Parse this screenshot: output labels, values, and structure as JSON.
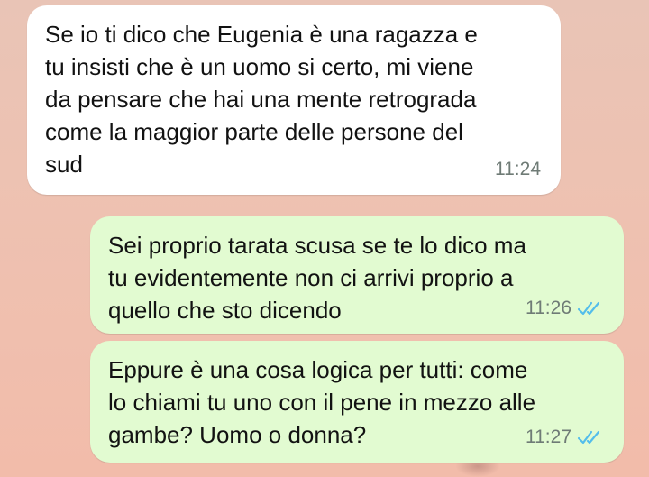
{
  "messages": [
    {
      "direction": "incoming",
      "text": "Se io ti dico che Eugenia è una ragazza e\ntu insisti che è un uomo si certo, mi viene\nda pensare che hai una mente retrograda\ncome la maggior parte delle persone del\nsud",
      "time": "11:24"
    },
    {
      "direction": "outgoing",
      "text": "Sei proprio tarata scusa se te lo dico ma\ntu evidentemente non ci arrivi proprio a\nquello che sto dicendo",
      "time": "11:26",
      "status_icon": "double-check-read-icon"
    },
    {
      "direction": "outgoing",
      "text": "Eppure è una cosa logica per tutti: come\nlo chiami tu uno con il pene in mezzo alle\ngambe? Uomo o donna?",
      "time": "11:27",
      "status_icon": "double-check-read-icon"
    }
  ],
  "colors": {
    "incoming_bubble": "#ffffff",
    "outgoing_bubble": "#e2fbd1",
    "read_ticks": "#53bdeb",
    "timestamp": "#6f7b76",
    "wallpaper": "#edc2b2"
  }
}
